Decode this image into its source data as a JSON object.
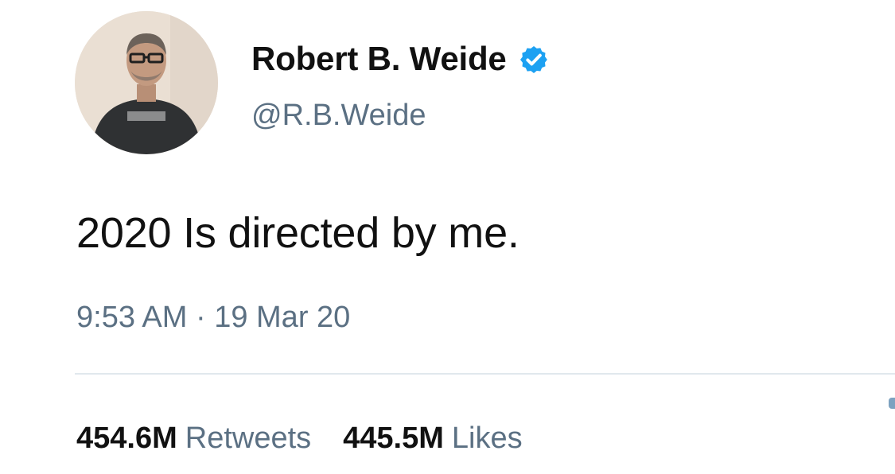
{
  "author": {
    "display_name": "Robert B. Weide",
    "handle": "@R.B.Weide",
    "verified": true,
    "verified_color": "#1da1f2"
  },
  "tweet": {
    "text": "2020 Is directed by me.",
    "time": "9:53 AM",
    "separator": "·",
    "date": "19 Mar 20"
  },
  "stats": {
    "retweets_count": "454.6M",
    "retweets_label": "Retweets",
    "likes_count": "445.5M",
    "likes_label": "Likes"
  },
  "icons": {
    "avatar": "avatar-photo",
    "verified": "verified-badge-icon"
  },
  "colors": {
    "text_primary": "#111111",
    "text_secondary": "#5b7083",
    "divider": "#e1e8ed"
  }
}
